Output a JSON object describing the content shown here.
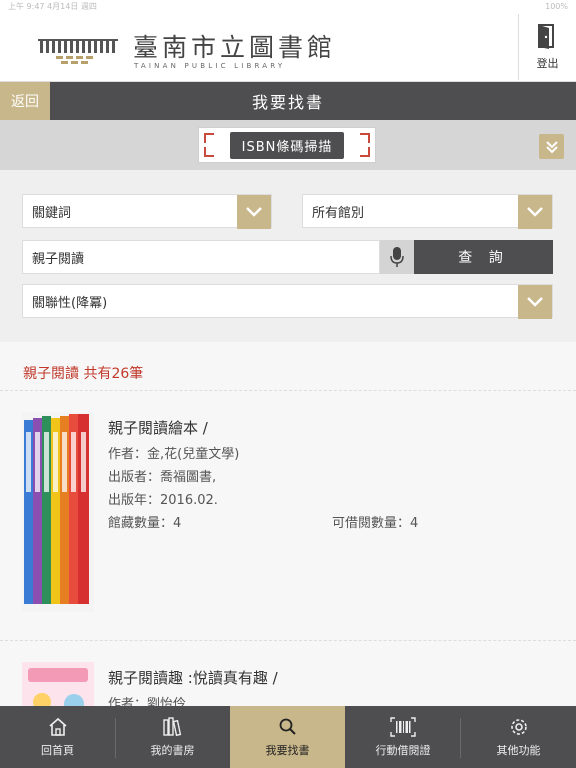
{
  "status_bar": {
    "left": "上午 9:47  4月14日 週四",
    "right": "100%"
  },
  "header": {
    "logo_title": "臺南市立圖書館",
    "logo_subtitle": "TAINAN PUBLIC LIBRARY",
    "logout_label": "登出"
  },
  "titlebar": {
    "back_label": "返回",
    "title": "我要找書"
  },
  "isbn": {
    "label": "ISBN條碼掃描"
  },
  "search": {
    "field_select": "關鍵詞",
    "branch_select": "所有館別",
    "query_value": "親子閱讀",
    "query_button": "查 詢",
    "sort_select": "關聯性(降冪)"
  },
  "results": {
    "count_text": "親子閱讀 共有26筆",
    "books": [
      {
        "title": "親子閱讀繪本 /",
        "author": "作者：金,花(兒童文學)",
        "publisher": "出版者：喬福圖書,",
        "year": "出版年：2016.02.",
        "holdings": "館藏數量：4",
        "available": "可借閱數量：4"
      },
      {
        "title": "親子閱讀趣 :悅讀真有趣 /",
        "author": "作者：劉怡伶"
      }
    ]
  },
  "bottom_nav": [
    {
      "label": "回首頁",
      "icon": "home-icon"
    },
    {
      "label": "我的書房",
      "icon": "bookshelf-icon"
    },
    {
      "label": "我要找書",
      "icon": "search-icon"
    },
    {
      "label": "行動借閱證",
      "icon": "barcode-icon"
    },
    {
      "label": "其他功能",
      "icon": "gear-icon"
    }
  ],
  "colors": {
    "accent": "#c8b78a",
    "dark": "#4e4e50",
    "highlight": "#c0392b"
  }
}
